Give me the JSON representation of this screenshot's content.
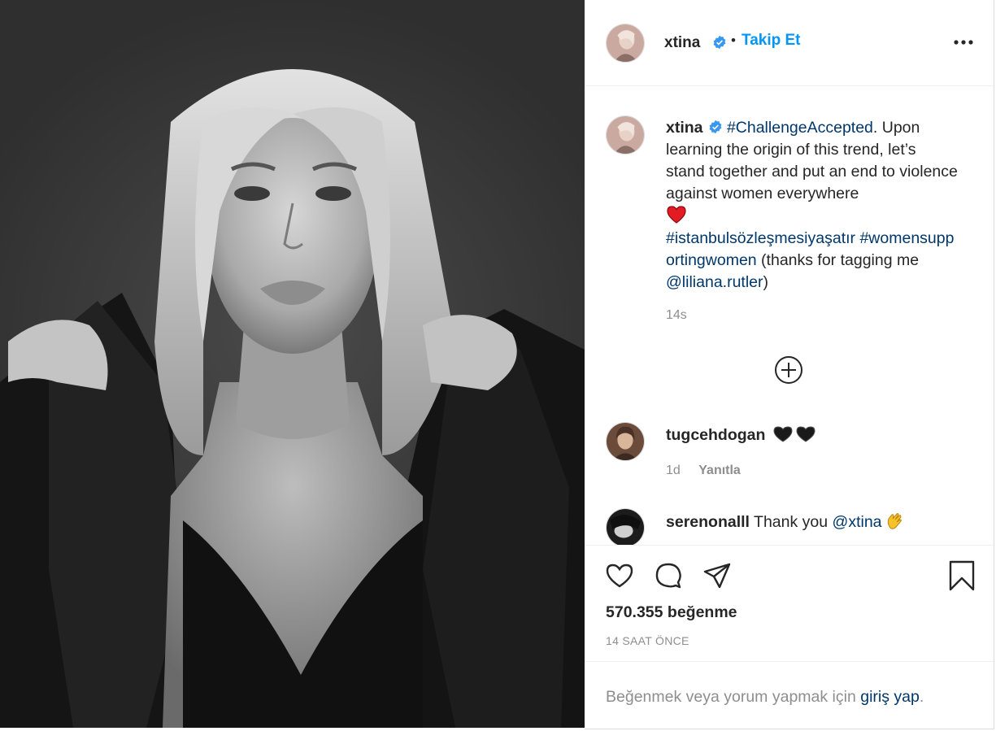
{
  "post": {
    "author": "xtina",
    "follow_separator": "•",
    "follow_label": "Takip Et",
    "more_icon": "more-options-icon",
    "caption": {
      "hashtag_1": "#ChallengeAccepted",
      "text_1": ". Upon learning the origin of this trend, let’s stand together and put an end to violence against women everywhere",
      "emoji": "red-heart",
      "hashtag_2": "#istanbulsözleşmesiyaşatır",
      "hashtag_3": "#womensupportingwomen",
      "text_2": " (thanks for tagging me ",
      "mention": "@liliana.rutler",
      "text_3": ")",
      "time": "14s"
    },
    "load_more_icon": "load-more-comments-icon",
    "comments": [
      {
        "user": "tugcehdogan",
        "text": "",
        "emojis": [
          "black-heart",
          "black-heart"
        ],
        "time": "1d",
        "reply_label": "Yanıtla"
      },
      {
        "user": "serenonalll",
        "text": "Thank you ",
        "mention": "@xtina",
        "emojis": [
          "clapping-hands"
        ]
      }
    ],
    "likes_label": "570.355 beğenme",
    "timestamp": "14 SAAT ÖNCE",
    "login_prompt": {
      "before": "Beğenmek veya yorum yapmak için ",
      "link": "giriş yap",
      "after": "."
    }
  },
  "colors": {
    "link_blue": "#00376b",
    "follow_blue": "#0095f6",
    "verified_blue": "#3897f0",
    "muted": "#8e8e8e",
    "text": "#262626"
  }
}
